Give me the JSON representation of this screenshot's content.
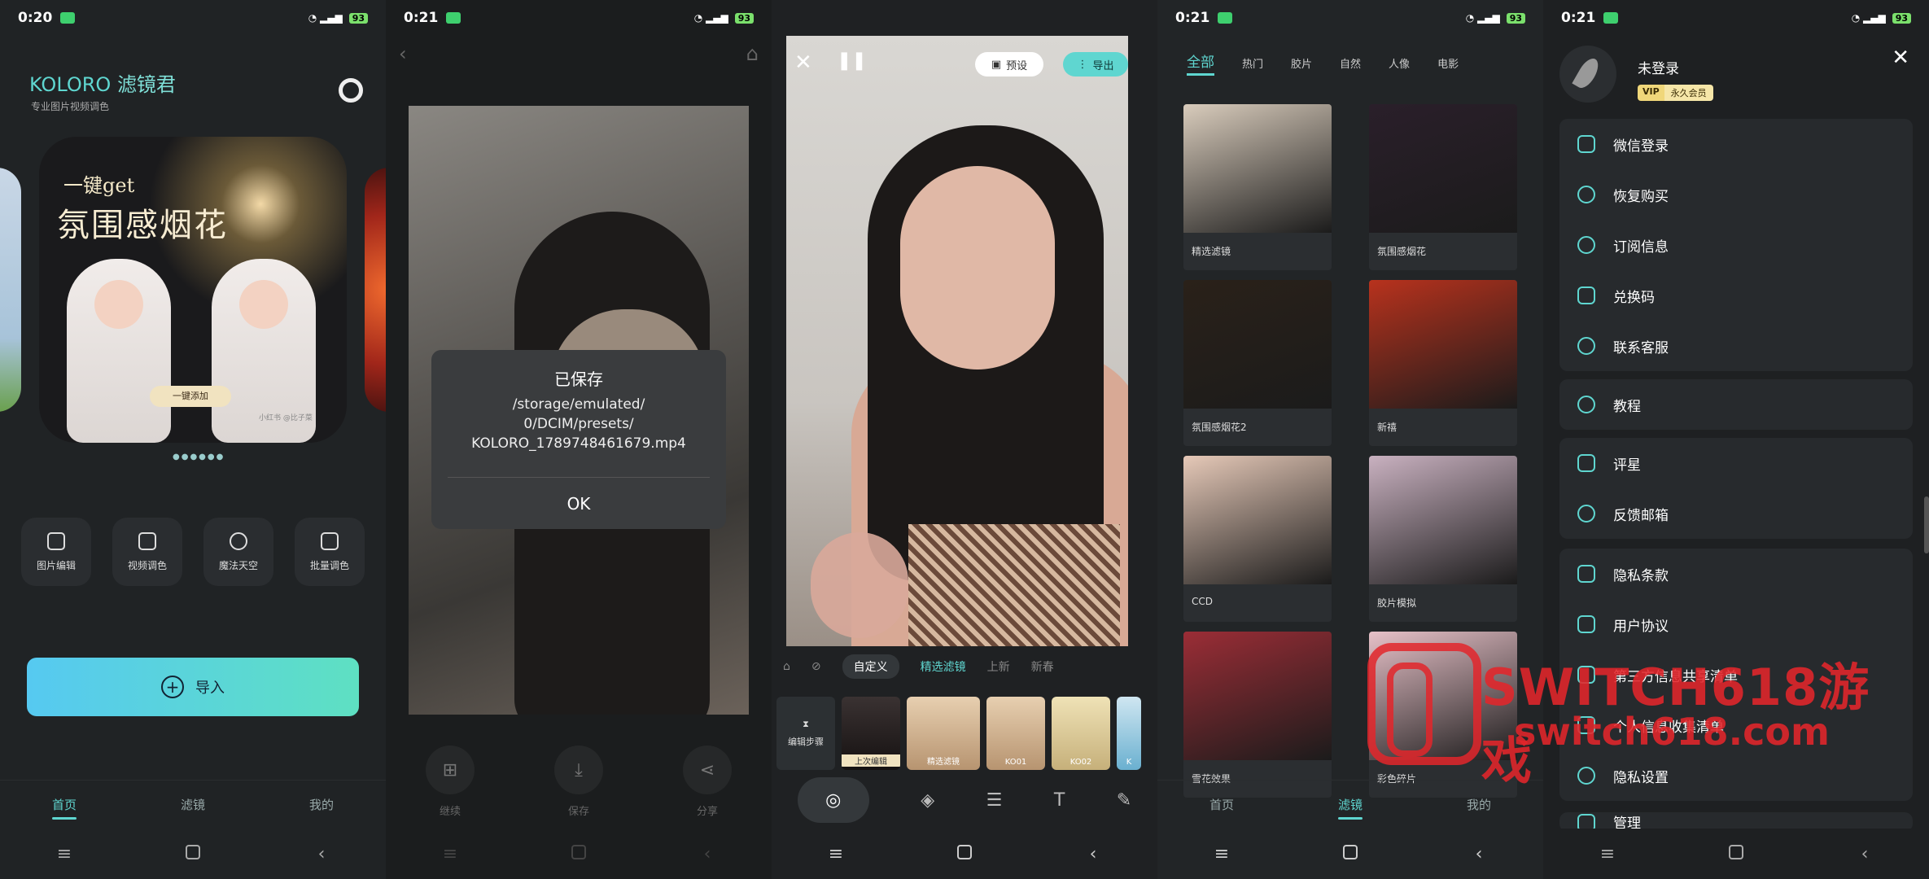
{
  "status": {
    "p1": {
      "time": "0:20",
      "battery": "93"
    },
    "p2": {
      "time": "0:21",
      "battery": "93"
    },
    "p4": {
      "time": "0:21",
      "battery": "93"
    },
    "p5": {
      "time": "0:21",
      "battery": "93"
    }
  },
  "home": {
    "brand": "KOLORO",
    "brand_cn": "滤镜君",
    "subtitle": "专业图片视频调色",
    "banner_line1": "一键get",
    "banner_line2": "氛围感烟花",
    "banner_button": "一键添加",
    "banner_watermark": "小红书 @比子菜",
    "tools": [
      "图片编辑",
      "视频调色",
      "魔法天空",
      "批量调色"
    ],
    "import_label": "导入",
    "tabs": [
      "首页",
      "滤镜",
      "我的"
    ]
  },
  "save_dialog": {
    "title": "已保存",
    "message": "/storage/emulated/\n0/DCIM/presets/\nKOLORO_1789748461679.mp4",
    "ok": "OK",
    "actions": [
      "继续",
      "保存",
      "分享"
    ]
  },
  "editor": {
    "preset_label": "预设",
    "export_label": "导出",
    "filter_tabs": [
      "自定义",
      "精选滤镜",
      "上新",
      "新春"
    ],
    "thumbs": [
      "编辑步骤",
      "上次编辑",
      "精选滤镜",
      "KO01",
      "KO02",
      "K"
    ]
  },
  "filters": {
    "categories": [
      "全部",
      "热门",
      "胶片",
      "自然",
      "人像",
      "电影"
    ],
    "items": [
      "精选滤镜",
      "氛围感烟花",
      "氛围感烟花2",
      "新禧",
      "CCD",
      "胶片模拟",
      "雪花效果",
      "彩色碎片"
    ],
    "colors": [
      "#d9ccbc",
      "#2a1f2a",
      "#2a2119",
      "#b8321d",
      "#e6c9b8",
      "#c9b1c0",
      "#9b2d36",
      "#e7c1c8"
    ],
    "tabs": [
      "首页",
      "滤镜",
      "我的"
    ]
  },
  "menu": {
    "username": "未登录",
    "vip": "VIP",
    "vip_type": "永久会员",
    "group1": [
      "微信登录",
      "恢复购买",
      "订阅信息",
      "兑换码",
      "联系客服"
    ],
    "group2": [
      "教程"
    ],
    "group3": [
      "评星",
      "反馈邮箱"
    ],
    "group4": [
      "隐私条款",
      "用户协议",
      "第三方信息共享清单",
      "个人信息收集清单",
      "隐私设置",
      "管理"
    ]
  },
  "watermark": {
    "line1": "SWITCH618游戏",
    "line2": "switch618.com"
  },
  "accent": "#5fd6d0"
}
